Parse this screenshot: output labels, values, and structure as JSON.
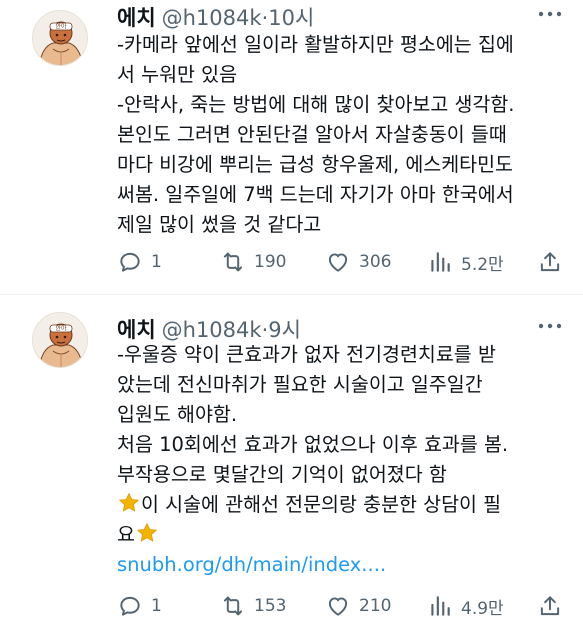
{
  "tweets": [
    {
      "author": "에치",
      "handle": "@h1084k",
      "time": "10시",
      "avatar_label": "안아",
      "lines": [
        "-카메라 앞에선 일이라 활발하지만 평소에는 집에",
        "서 누워만 있음",
        "-안락사, 죽는 방법에 대해 많이 찾아보고 생각함.",
        "본인도 그러면 안된단걸 알아서 자살충동이 들때",
        "마다 비강에 뿌리는 급성 항우울제, 에스케타민도",
        "써봄. 일주일에 7백 드는데 자기가 아마 한국에서",
        "제일 많이 썼을 것 같다고"
      ],
      "stats": {
        "replies": "1",
        "retweets": "190",
        "likes": "306",
        "views": "5.2만"
      }
    },
    {
      "author": "에치",
      "handle": "@h1084k",
      "time": "9시",
      "avatar_label": "안아",
      "lines": [
        "-우울증 약이 큰효과가 없자 전기경련치료를 받",
        "았는데 전신마취가 필요한 시술이고 일주일간",
        "입원도 해야함.",
        "처음 10회에선 효과가 없었으나 이후 효과를 봄.",
        "부작용으로 몇달간의 기억이 없어졌다 함"
      ],
      "star_line_1": "이 시술에 관해선 전문의랑 충분한 상담이 필",
      "star_line_2": "요",
      "link": "snubh.org/dh/main/index....",
      "stats": {
        "replies": "1",
        "retweets": "153",
        "likes": "210",
        "views": "4.9만"
      }
    }
  ],
  "icons": [
    "more-icon",
    "reply-icon",
    "retweet-icon",
    "like-icon",
    "views-icon",
    "share-icon",
    "star-emoji"
  ],
  "colors": {
    "text": "#0f1419",
    "secondary": "#536471",
    "link": "#1d9bf0",
    "divider": "#eff3f4",
    "star": "#f5b301"
  }
}
